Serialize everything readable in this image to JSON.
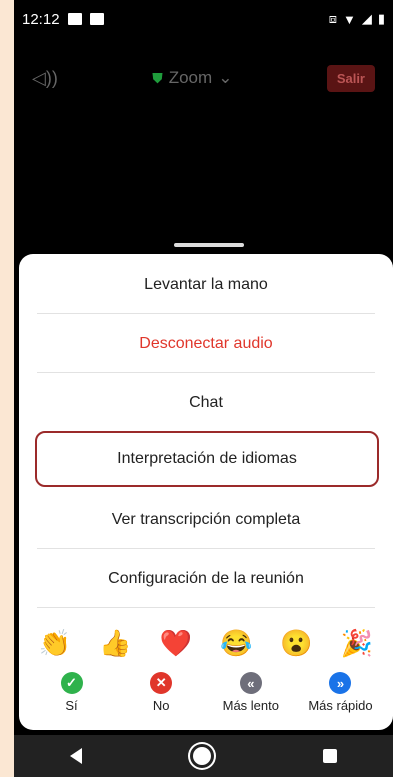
{
  "status_bar": {
    "time": "12:12"
  },
  "top_bar": {
    "title": "Zoom",
    "leave_label": "Salir"
  },
  "menu": {
    "items": [
      {
        "label": "Levantar la mano"
      },
      {
        "label": "Desconectar audio"
      },
      {
        "label": "Chat"
      },
      {
        "label": "Interpretación de idiomas"
      },
      {
        "label": "Ver transcripción completa"
      },
      {
        "label": "Configuración de la reunión"
      }
    ]
  },
  "reactions": [
    {
      "icon": "clap-icon",
      "glyph": "👏"
    },
    {
      "icon": "thumbs-up-icon",
      "glyph": "👍"
    },
    {
      "icon": "heart-icon",
      "glyph": "❤️"
    },
    {
      "icon": "tears-of-joy-icon",
      "glyph": "😂"
    },
    {
      "icon": "surprised-icon",
      "glyph": "😮"
    },
    {
      "icon": "party-popper-icon",
      "glyph": "🎉"
    }
  ],
  "feedback": [
    {
      "label": "Sí",
      "color": "#2fb24c"
    },
    {
      "label": "No",
      "color": "#e0362b"
    },
    {
      "label": "Más lento",
      "color": "#6e6e7a"
    },
    {
      "label": "Más rápido",
      "color": "#1a73e8"
    }
  ]
}
